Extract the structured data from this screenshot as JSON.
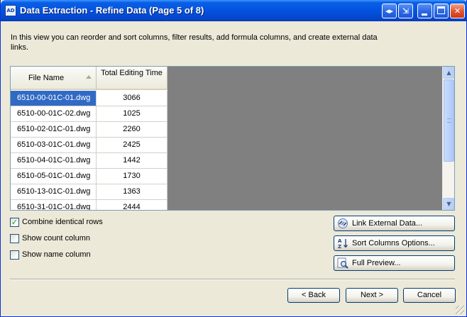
{
  "window": {
    "title": "Data Extraction - Refine Data (Page 5 of 8)",
    "app_icon_text": "AD",
    "help_icon": "expand-arrows-icon",
    "collapse_icon": "collapse-window-icon"
  },
  "instructions": "In this view you can reorder and sort columns, filter results, add formula columns, and create external data links.",
  "grid": {
    "columns": [
      "File Name",
      "Total Editing Time"
    ],
    "sort_column": "File Name",
    "sort_direction": "ascending",
    "rows": [
      {
        "name": "6510-00-01C-01.dwg",
        "time": "3066",
        "selected": true
      },
      {
        "name": "6510-00-01C-02.dwg",
        "time": "1025"
      },
      {
        "name": "6510-02-01C-01.dwg",
        "time": "2260"
      },
      {
        "name": "6510-03-01C-01.dwg",
        "time": "2425"
      },
      {
        "name": "6510-04-01C-01.dwg",
        "time": "1442"
      },
      {
        "name": "6510-05-01C-01.dwg",
        "time": "1730"
      },
      {
        "name": "6510-13-01C-01.dwg",
        "time": "1363"
      },
      {
        "name": "6510-31-01C-01.dwg",
        "time": "2444"
      }
    ]
  },
  "options": {
    "combine": {
      "label": "Combine identical rows",
      "checked": true
    },
    "count": {
      "label": "Show count column",
      "checked": false
    },
    "name": {
      "label": "Show name column",
      "checked": false
    }
  },
  "actions": {
    "link": "Link External Data...",
    "sort": "Sort Columns Options...",
    "preview": "Full Preview..."
  },
  "nav": {
    "back": "< Back",
    "next": "Next >",
    "cancel": "Cancel"
  },
  "colors": {
    "titlebar": "#0453df",
    "selection": "#316ac5",
    "grid_background": "#808080",
    "dialog": "#ece9d8"
  }
}
